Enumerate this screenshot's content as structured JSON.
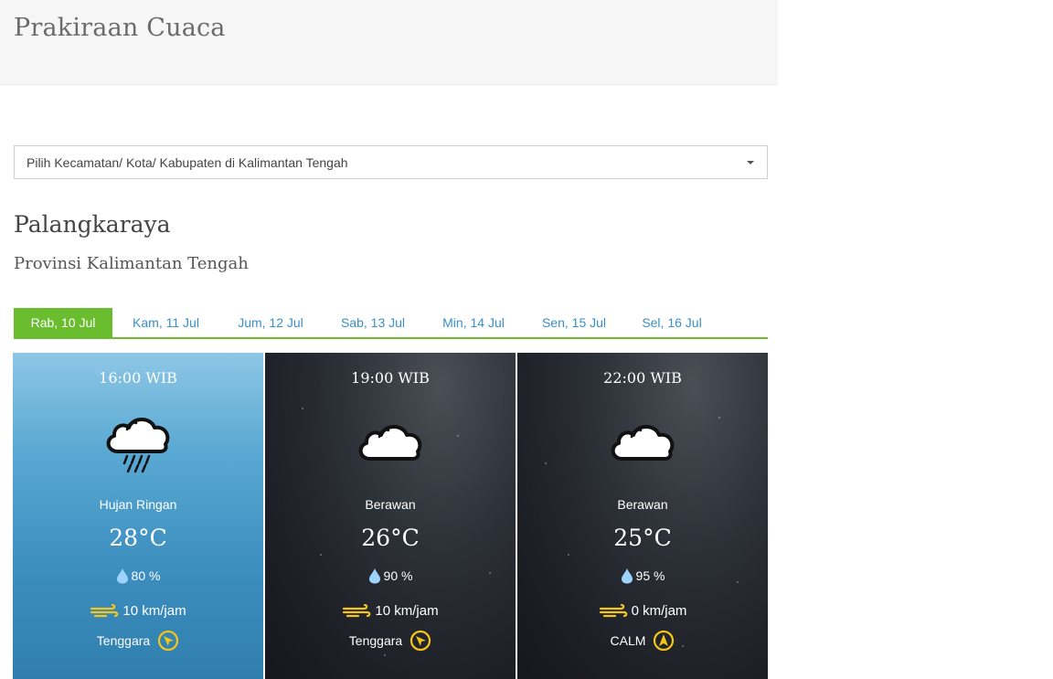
{
  "header": {
    "title": "Prakiraan Cuaca"
  },
  "location_select": {
    "label": "Pilih Kecamatan/ Kota/ Kabupaten di Kalimantan Tengah"
  },
  "location": {
    "city": "Palangkaraya",
    "province": "Provinsi Kalimantan Tengah"
  },
  "tabs": [
    {
      "label": "Rab, 10 Jul",
      "active": true
    },
    {
      "label": "Kam, 11 Jul",
      "active": false
    },
    {
      "label": "Jum, 12 Jul",
      "active": false
    },
    {
      "label": "Sab, 13 Jul",
      "active": false
    },
    {
      "label": "Min, 14 Jul",
      "active": false
    },
    {
      "label": "Sen, 15 Jul",
      "active": false
    },
    {
      "label": "Sel, 16 Jul",
      "active": false
    }
  ],
  "forecasts": [
    {
      "time": "16:00 WIB",
      "icon": "cloud-rain-icon",
      "condition": "Hujan Ringan",
      "temperature": "28°C",
      "humidity": "80 %",
      "wind_speed": "10 km/jam",
      "wind_direction": "Tenggara",
      "theme": "day"
    },
    {
      "time": "19:00 WIB",
      "icon": "cloud-icon",
      "condition": "Berawan",
      "temperature": "26°C",
      "humidity": "90 %",
      "wind_speed": "10 km/jam",
      "wind_direction": "Tenggara",
      "theme": "night"
    },
    {
      "time": "22:00 WIB",
      "icon": "cloud-icon",
      "condition": "Berawan",
      "temperature": "25°C",
      "humidity": "95 %",
      "wind_speed": "0 km/jam",
      "wind_direction": "CALM",
      "theme": "night"
    }
  ],
  "colors": {
    "accent_green": "#6abd2f",
    "tab_link_blue": "#3a8fc8",
    "icon_yellow": "#f5c518",
    "drop_blue": "#9fd3ff"
  }
}
